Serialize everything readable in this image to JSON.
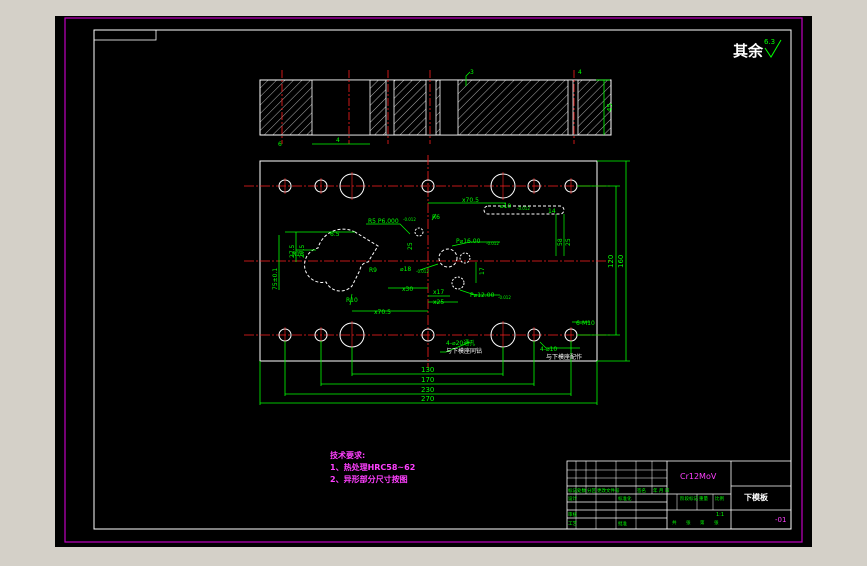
{
  "colors": {
    "background": "#d4d0c8",
    "sheet": "#000000",
    "frame": "#c000c0",
    "border": "#ffffff",
    "dimension": "#00ff00",
    "center_line": "#ff2020",
    "hatch": "#ffffff",
    "title_green": "#00ff00",
    "title_magenta": "#ff40ff"
  },
  "surface_finish": {
    "label": "其余",
    "value": "6.3"
  },
  "section_view": {
    "height_dim": "45",
    "width_dim": "4",
    "callout_top": "3",
    "callout_right": "4",
    "callout_bottom_left": "6"
  },
  "plan_dims": {
    "total_width": "270",
    "width_230": "230",
    "width_170": "170",
    "width_130": "130",
    "height_160": "160",
    "height_120": "120",
    "x_70_5_top": "x70.5",
    "x_70_5_bottom": "x70.5",
    "x_30": "x30",
    "x_17": "x17",
    "x_25": "x25",
    "y_17": "17",
    "y_25": "25",
    "y_30_left": "27.5",
    "y_57_left": "27.5",
    "y_75": "75±0.1",
    "slot_dim": "63",
    "slot_width": "14",
    "right_dim_58": "58",
    "right_dim_25": "25",
    "r16": "R16",
    "r10": "R10",
    "r9": "R9",
    "r5": "R5",
    "r6_5": "6.5",
    "r6": "R6",
    "hole_p5": "R5  P6.000",
    "hole_p5_tol": "-0.012",
    "hole_phi18": "⌀18",
    "hole_phi18_tol": "-0.012",
    "hole_phi16": "P⌀16.00",
    "hole_phi16_tol": "-0.012",
    "hole_phi12": "P⌀12.00",
    "hole_phi12_tol": "-0.012",
    "slot_callout": "⌀10",
    "slot_callout_tol": "-0.012",
    "note_holes_left": "4-⌀20通孔",
    "note_holes_left_sub": "与下模座同钻",
    "note_holes_right": "4-⌀10",
    "note_holes_right_sub": "与下模座配作",
    "m10_callout": "6-M10"
  },
  "tech_requirements": {
    "title": "技术要求:",
    "items": [
      "1、热处理HRC58~62",
      "2、异形部分尺寸按图"
    ]
  },
  "title_block": {
    "material": "Cr12MoV",
    "part_name": "下模板",
    "drawing_no": "-01",
    "scale": "1:1",
    "row_headers": [
      "标记",
      "处数",
      "分区",
      "更改文件号",
      "签名",
      "年 月 日"
    ],
    "role_labels": [
      "设计",
      "审核",
      "工艺"
    ],
    "col_labels": [
      "标准化",
      "批准"
    ],
    "stage_labels": [
      "阶段标记",
      "重量",
      "比例"
    ],
    "sheet_labels": [
      "共",
      "张",
      "第",
      "张"
    ]
  }
}
